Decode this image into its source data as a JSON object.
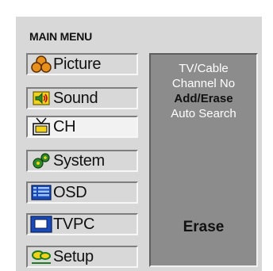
{
  "menu": {
    "title": "MAIN MENU",
    "items": [
      {
        "label": "Picture",
        "icon": "picture-icon"
      },
      {
        "label": "Sound",
        "icon": "speaker-icon"
      },
      {
        "label": "CH",
        "icon": "tv-antenna-icon"
      },
      {
        "label": "System",
        "icon": "gears-icon"
      },
      {
        "label": "OSD",
        "icon": "osd-list-icon"
      },
      {
        "label": "TVPC",
        "icon": "monitor-icon"
      },
      {
        "label": "Setup",
        "icon": "setup-icon"
      }
    ],
    "selected": "CH"
  },
  "submenu": {
    "items": [
      "TV/Cable",
      "Channel No",
      "Add/Erase",
      "Auto Search"
    ],
    "active": "Add/Erase",
    "value": "Erase"
  },
  "colors": {
    "panel_bg": "#d8d8d8",
    "submenu_bg": "#8c8c8c",
    "selected_item_bg": "#f2f2f2",
    "icon_orange": "#e8901c",
    "icon_yellow": "#f2d21a",
    "icon_green": "#2e8b2a",
    "icon_blue": "#1a4ab8"
  }
}
